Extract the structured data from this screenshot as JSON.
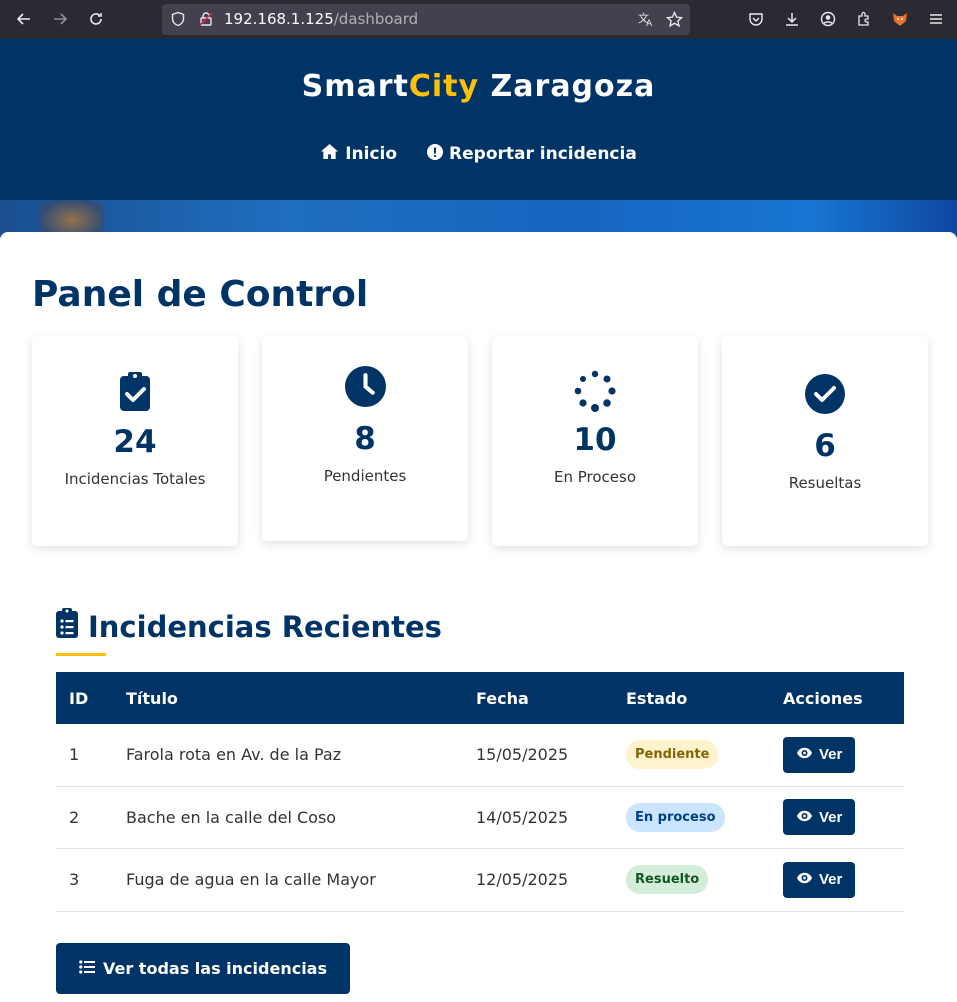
{
  "browser": {
    "url_host": "192.168.1.125",
    "url_path": "/dashboard"
  },
  "header": {
    "brand_part1": "Smart",
    "brand_part2": "City",
    "brand_part3": " Zaragoza",
    "nav": [
      {
        "label": "Inicio",
        "icon": "home-icon"
      },
      {
        "label": "Reportar incidencia",
        "icon": "exclamation-circle-icon"
      }
    ]
  },
  "colors": {
    "primary": "#003366",
    "accent": "#ffc107"
  },
  "main": {
    "title": "Panel de Control",
    "stats": [
      {
        "value": "24",
        "label": "Incidencias Totales",
        "icon": "clipboard-check-icon"
      },
      {
        "value": "8",
        "label": "Pendientes",
        "icon": "clock-icon"
      },
      {
        "value": "10",
        "label": "En Proceso",
        "icon": "spinner-icon"
      },
      {
        "value": "6",
        "label": "Resueltas",
        "icon": "check-circle-icon"
      }
    ],
    "recent_title": "Incidencias Recientes",
    "table": {
      "headers": [
        "ID",
        "Título",
        "Fecha",
        "Estado",
        "Acciones"
      ],
      "rows": [
        {
          "id": "1",
          "title": "Farola rota en Av. de la Paz",
          "date": "15/05/2025",
          "status": "Pendiente",
          "action": "Ver"
        },
        {
          "id": "2",
          "title": "Bache en la calle del Coso",
          "date": "14/05/2025",
          "status": "En proceso",
          "action": "Ver"
        },
        {
          "id": "3",
          "title": "Fuga de agua en la calle Mayor",
          "date": "12/05/2025",
          "status": "Resuelto",
          "action": "Ver"
        }
      ]
    },
    "view_all_label": "Ver todas las incidencias"
  }
}
